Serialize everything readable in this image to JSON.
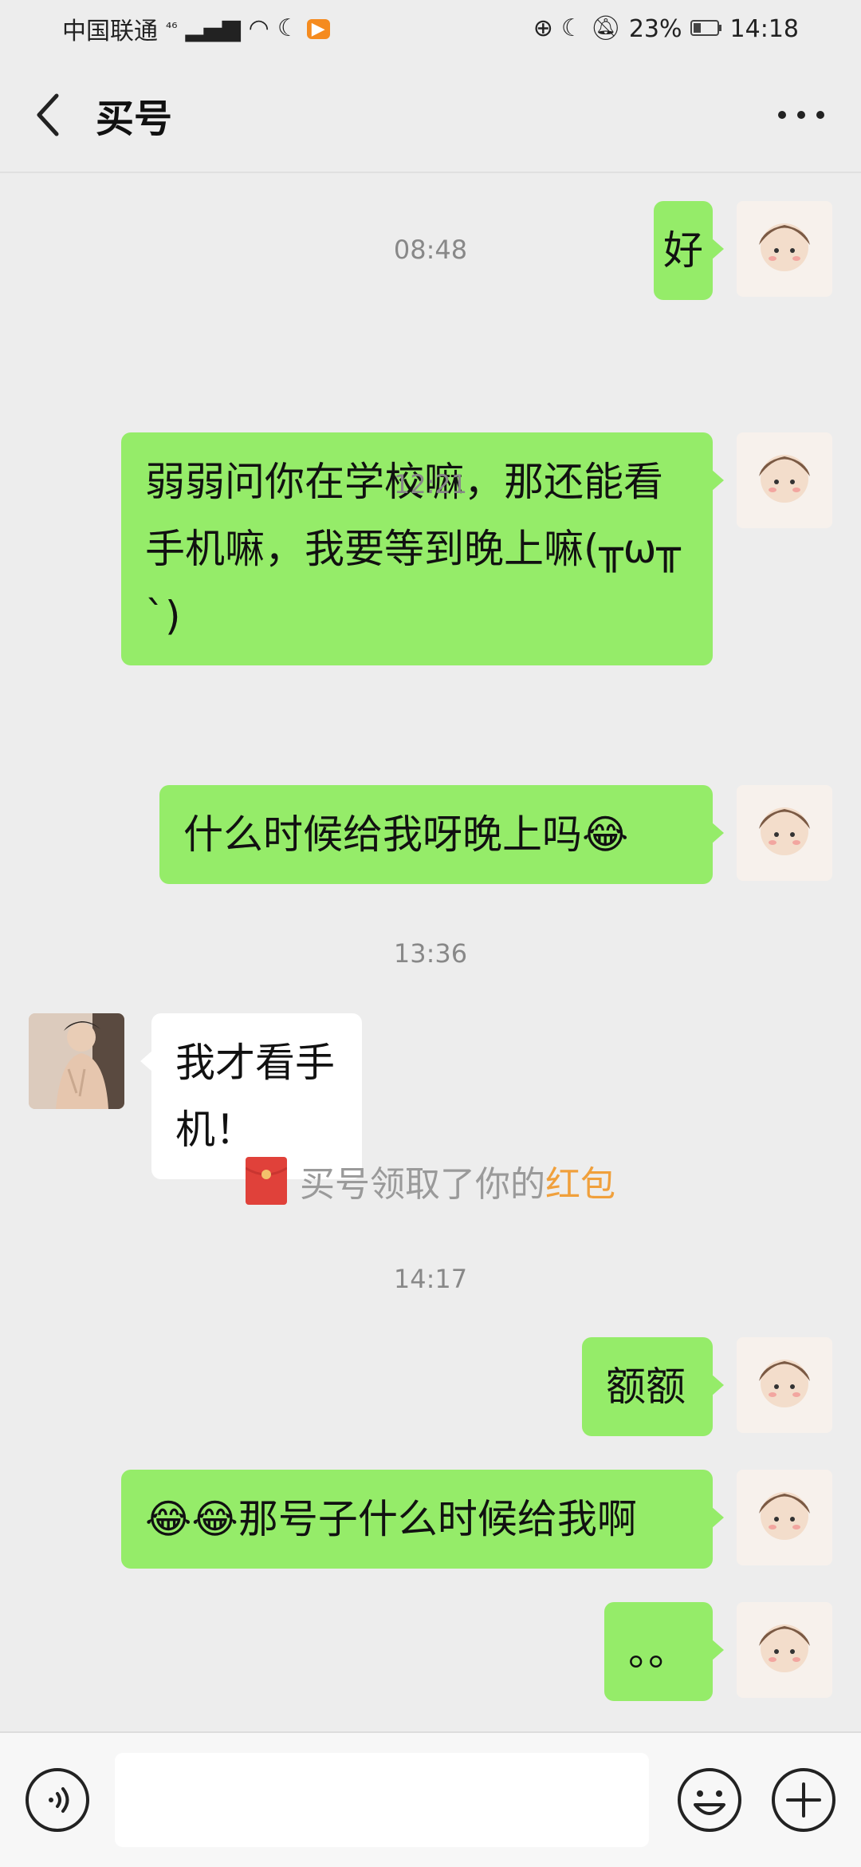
{
  "status_bar": {
    "carrier": "中国联通",
    "network": "⁴⁶",
    "battery_percent": "23%",
    "time": "14:18"
  },
  "header": {
    "title": "买号"
  },
  "messages": [
    {
      "side": "out",
      "text": "好"
    },
    {
      "timestamp": "08:48"
    },
    {
      "side": "out",
      "text": "弱弱问你在学校嘛，那还能看手机嘛，我要等到晚上嘛(╥ω╥`)"
    },
    {
      "timestamp": "12:21"
    },
    {
      "side": "out",
      "text": "什么时候给我呀晚上吗😂"
    },
    {
      "timestamp": "13:36"
    },
    {
      "side": "in",
      "text": "我才看手机！"
    },
    {
      "system": "买号领取了你的",
      "link": "红包"
    },
    {
      "timestamp": "14:17"
    },
    {
      "side": "out",
      "text": "额额"
    },
    {
      "side": "out",
      "text": "😂😂那号子什么时候给我啊"
    },
    {
      "side": "out",
      "text": "。。"
    }
  ],
  "input": {
    "placeholder": ""
  }
}
